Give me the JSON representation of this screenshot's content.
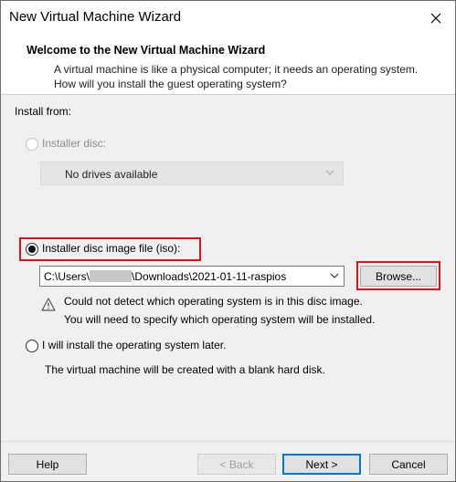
{
  "window": {
    "title": "New Virtual Machine Wizard"
  },
  "header": {
    "title": "Welcome to the New Virtual Machine Wizard",
    "description": "A virtual machine is like a physical computer; it needs an operating system. How will you install the guest operating system?"
  },
  "install_from": {
    "label": "Install from:",
    "disc": {
      "label": "Installer disc:",
      "selected": false,
      "enabled": false,
      "drive_value": "No drives available"
    },
    "iso": {
      "label": "Installer disc image file (iso):",
      "selected": true,
      "path_prefix": "C:\\Users\\",
      "path_suffix": "\\Downloads\\2021-01-11-raspios",
      "browse_label": "Browse...",
      "warning_line1": "Could not detect which operating system is in this disc image.",
      "warning_line2": "You will need to specify which operating system will be installed."
    },
    "later": {
      "label": "I will install the operating system later.",
      "selected": false,
      "note": "The virtual machine will be created with a blank hard disk."
    }
  },
  "footer": {
    "help_label": "Help",
    "back_label": "< Back",
    "next_label": "Next >",
    "cancel_label": "Cancel"
  },
  "colors": {
    "highlight": "#e0121b",
    "accent": "#0078d7"
  }
}
